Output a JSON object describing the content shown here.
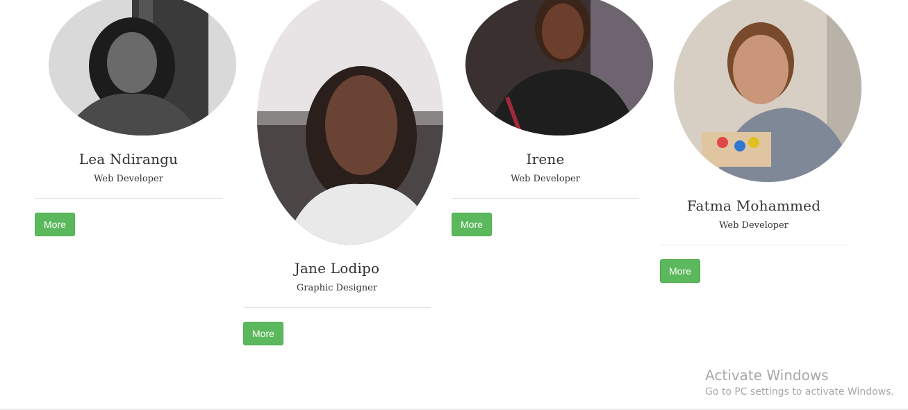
{
  "team": [
    {
      "name": "Lea Ndirangu",
      "role": "Web Developer",
      "button": "More",
      "photo": "portrait-photo"
    },
    {
      "name": "Jane Lodipo",
      "role": "Graphic Designer",
      "button": "More",
      "photo": "portrait-photo"
    },
    {
      "name": "Irene",
      "role": "Web Developer",
      "button": "More",
      "photo": "portrait-photo"
    },
    {
      "name": "Fatma Mohammed",
      "role": "Web Developer",
      "button": "More",
      "photo": "portrait-photo"
    }
  ],
  "watermark": {
    "title": "Activate Windows",
    "subtitle": "Go to PC settings to activate Windows."
  },
  "colors": {
    "button": "#5cb85c",
    "text": "#333333",
    "watermark": "#a8a8a8"
  }
}
